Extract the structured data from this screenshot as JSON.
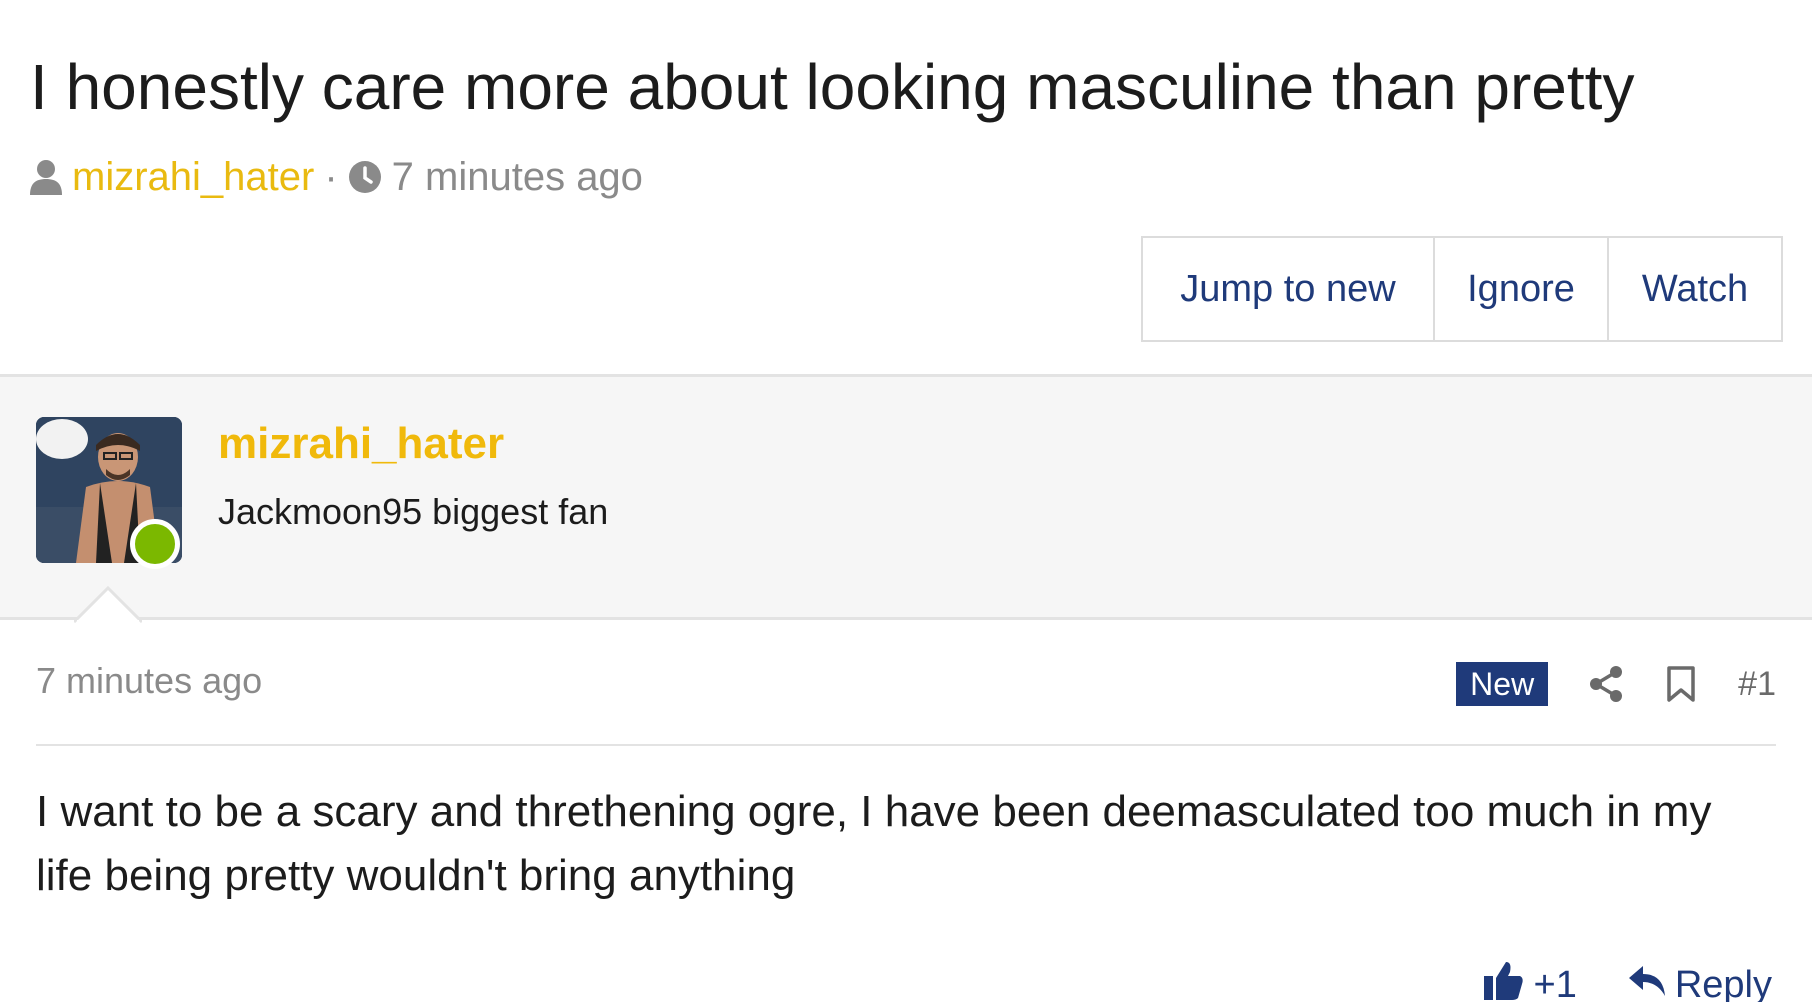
{
  "thread": {
    "title": "I honestly care more about looking masculine than pretty",
    "author": "mizrahi_hater",
    "separator": "·",
    "time": "7 minutes ago"
  },
  "buttons": {
    "jump_to_new": "Jump to new",
    "ignore": "Ignore",
    "watch": "Watch"
  },
  "post": {
    "username": "mizrahi_hater",
    "user_title": "Jackmoon95 biggest fan",
    "online": true,
    "time": "7 minutes ago",
    "new_badge": "New",
    "post_number": "#1",
    "body": "I want to be a scary and threthening ogre, I have been deemasculated too much in my life being pretty wouldn't bring anything",
    "like_label": "+1",
    "reply_label": "Reply"
  },
  "colors": {
    "accent_yellow": "#f0b90b",
    "link_blue": "#1f3a7a",
    "online_green": "#7bb800",
    "muted_gray": "#8a8a8a"
  },
  "icons": [
    "user-icon",
    "clock-icon",
    "share-icon",
    "bookmark-icon",
    "thumbs-up-icon",
    "reply-icon"
  ]
}
